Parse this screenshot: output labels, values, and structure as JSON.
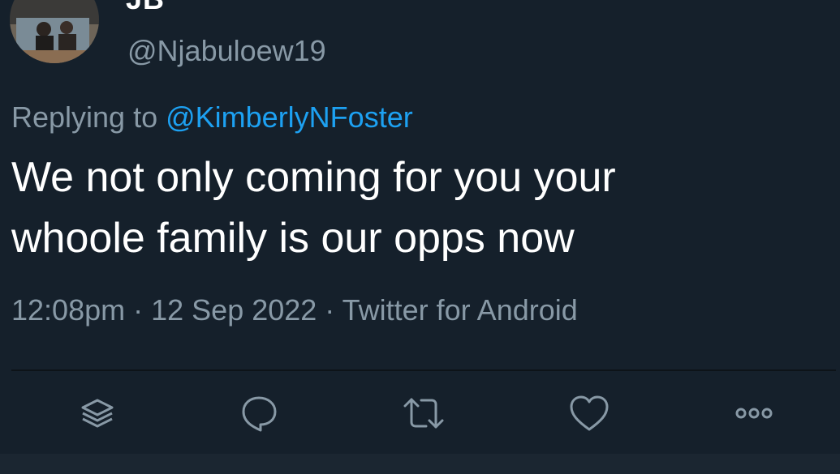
{
  "author": {
    "display_name": "JB",
    "handle": "@Njabuloew19"
  },
  "reply": {
    "prefix": "Replying to ",
    "mention": "@KimberlyNFoster"
  },
  "tweet": {
    "line1": "We not only coming for you your",
    "line2": "whoole family is our opps now"
  },
  "meta": {
    "time": "12:08pm",
    "separator": " · ",
    "date": "12 Sep 2022",
    "source": "Twitter for Android"
  },
  "actions": [
    {
      "icon": "layers-icon"
    },
    {
      "icon": "reply-bubble-icon"
    },
    {
      "icon": "retweet-icon"
    },
    {
      "icon": "heart-icon"
    },
    {
      "icon": "more-dots-icon"
    }
  ],
  "colors": {
    "background": "#15202b",
    "text": "#ffffff",
    "secondary": "#8899a6",
    "accent": "#1da1f2"
  }
}
